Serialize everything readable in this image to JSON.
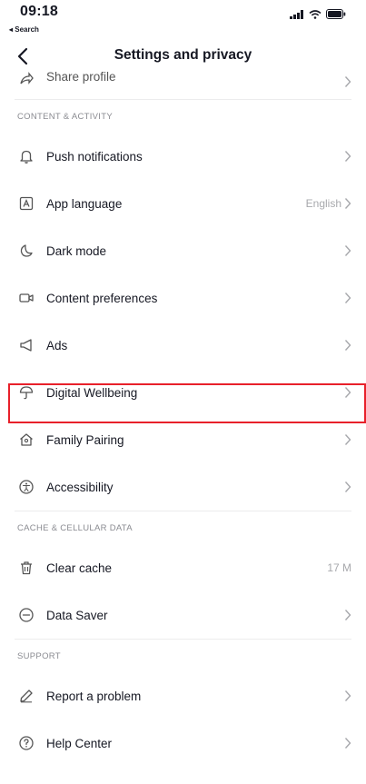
{
  "status_bar": {
    "time": "09:18",
    "back_label": "◂ Search"
  },
  "nav": {
    "title": "Settings and privacy"
  },
  "partial_row": {
    "label": "Share profile"
  },
  "sections": [
    {
      "header": "CONTENT & ACTIVITY",
      "items": [
        {
          "label": "Push notifications",
          "icon": "bell-icon"
        },
        {
          "label": "App language",
          "icon": "language-icon",
          "value": "English"
        },
        {
          "label": "Dark mode",
          "icon": "moon-icon"
        },
        {
          "label": "Content preferences",
          "icon": "video-icon"
        },
        {
          "label": "Ads",
          "icon": "megaphone-icon"
        },
        {
          "label": "Digital Wellbeing",
          "icon": "umbrella-icon"
        },
        {
          "label": "Family Pairing",
          "icon": "home-icon"
        },
        {
          "label": "Accessibility",
          "icon": "accessibility-icon"
        }
      ]
    },
    {
      "header": "CACHE & CELLULAR DATA",
      "items": [
        {
          "label": "Clear cache",
          "icon": "trash-icon",
          "value": "17 M"
        },
        {
          "label": "Data Saver",
          "icon": "data-saver-icon"
        }
      ]
    },
    {
      "header": "SUPPORT",
      "items": [
        {
          "label": "Report a problem",
          "icon": "pencil-icon"
        },
        {
          "label": "Help Center",
          "icon": "help-icon"
        }
      ]
    }
  ],
  "colors": {
    "highlight": "#e8202a",
    "text": "#161823",
    "muted": "#a7a8ac"
  }
}
